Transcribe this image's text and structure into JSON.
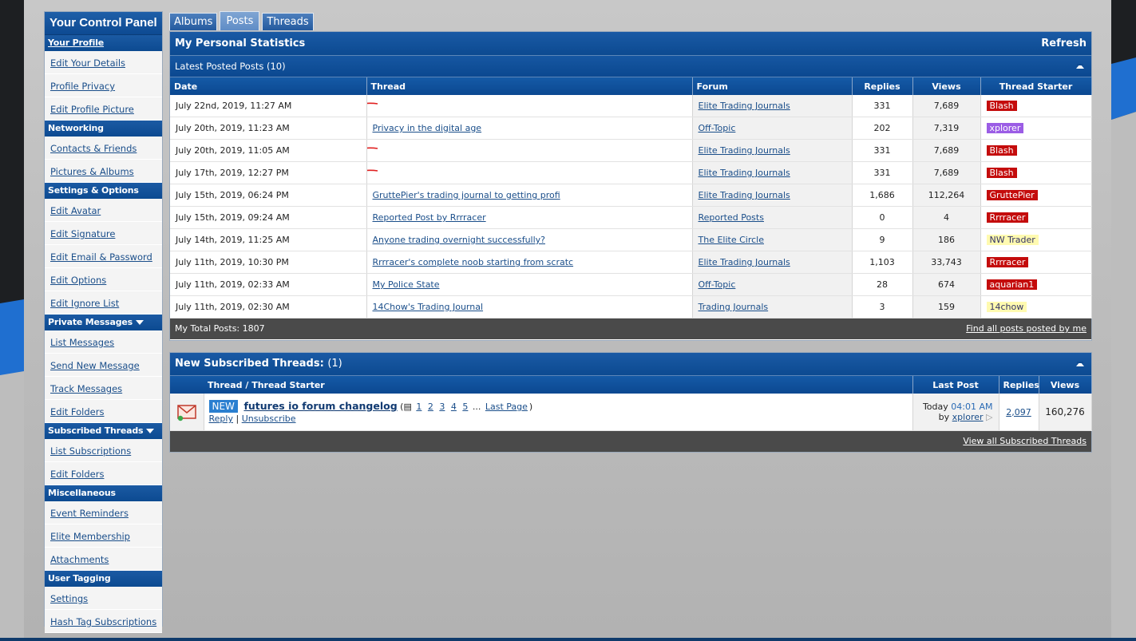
{
  "tabs": [
    {
      "label": "Albums",
      "active": false
    },
    {
      "label": "Posts",
      "active": true
    },
    {
      "label": "Threads",
      "active": false
    }
  ],
  "sidebar": {
    "title": "Your Control Panel",
    "sections": [
      {
        "heading": "Your Profile",
        "link": true,
        "caret": false,
        "items": [
          "Edit Your Details",
          "Profile Privacy",
          "Edit Profile Picture"
        ]
      },
      {
        "heading": "Networking",
        "link": false,
        "caret": false,
        "items": [
          "Contacts & Friends",
          "Pictures & Albums"
        ]
      },
      {
        "heading": "Settings & Options",
        "link": false,
        "caret": false,
        "items": [
          "Edit Avatar",
          "Edit Signature",
          "Edit Email & Password",
          "Edit Options",
          "Edit Ignore List"
        ]
      },
      {
        "heading": "Private Messages",
        "link": false,
        "caret": true,
        "items": [
          "List Messages",
          "Send New Message",
          "Track Messages",
          "Edit Folders"
        ]
      },
      {
        "heading": "Subscribed Threads",
        "link": false,
        "caret": true,
        "items": [
          "List Subscriptions",
          "Edit Folders"
        ]
      },
      {
        "heading": "Miscellaneous",
        "link": false,
        "caret": false,
        "items": [
          "Event Reminders",
          "Elite Membership",
          "Attachments"
        ]
      },
      {
        "heading": "User Tagging",
        "link": false,
        "caret": false,
        "items": [
          "Settings",
          "Hash Tag Subscriptions"
        ]
      }
    ]
  },
  "stats": {
    "title": "My Personal Statistics",
    "refresh_label": "Refresh",
    "subtitle": "Latest Posted Posts (10)",
    "columns": [
      "Date",
      "Thread",
      "Forum",
      "Replies",
      "Views",
      "Thread Starter"
    ],
    "rows": [
      {
        "date": "July 22nd, 2019, 11:27 AM",
        "thread": "",
        "forum": "Elite Trading Journals",
        "replies": "331",
        "views": "7,689",
        "starter": "Blash",
        "badge": "red",
        "redacted": true
      },
      {
        "date": "July 20th, 2019, 11:23 AM",
        "thread": "Privacy in the digital age",
        "forum": "Off-Topic",
        "replies": "202",
        "views": "7,319",
        "starter": "xplorer",
        "badge": "purple",
        "redacted": false
      },
      {
        "date": "July 20th, 2019, 11:05 AM",
        "thread": "",
        "forum": "Elite Trading Journals",
        "replies": "331",
        "views": "7,689",
        "starter": "Blash",
        "badge": "red",
        "redacted": true
      },
      {
        "date": "July 17th, 2019, 12:27 PM",
        "thread": "",
        "forum": "Elite Trading Journals",
        "replies": "331",
        "views": "7,689",
        "starter": "Blash",
        "badge": "red",
        "redacted": true
      },
      {
        "date": "July 15th, 2019, 06:24 PM",
        "thread": "GruttePier's trading journal to getting profi",
        "forum": "Elite Trading Journals",
        "replies": "1,686",
        "views": "112,264",
        "starter": "GruttePier",
        "badge": "red",
        "redacted": false
      },
      {
        "date": "July 15th, 2019, 09:24 AM",
        "thread": "Reported Post by Rrrracer",
        "forum": "Reported Posts",
        "replies": "0",
        "views": "4",
        "starter": "Rrrracer",
        "badge": "red",
        "redacted": false
      },
      {
        "date": "July 14th, 2019, 11:25 AM",
        "thread": "Anyone trading overnight successfully?",
        "forum": "The Elite Circle",
        "replies": "9",
        "views": "186",
        "starter": "NW Trader",
        "badge": "yellow",
        "redacted": false
      },
      {
        "date": "July 11th, 2019, 10:30 PM",
        "thread": "Rrrracer's complete noob starting from scratc",
        "forum": "Elite Trading Journals",
        "replies": "1,103",
        "views": "33,743",
        "starter": "Rrrracer",
        "badge": "red",
        "redacted": false
      },
      {
        "date": "July 11th, 2019, 02:33 AM",
        "thread": "My Police State",
        "forum": "Off-Topic",
        "replies": "28",
        "views": "674",
        "starter": "aquarian1",
        "badge": "red",
        "redacted": false
      },
      {
        "date": "July 11th, 2019, 02:30 AM",
        "thread": "14Chow's Trading Journal",
        "forum": "Trading Journals",
        "replies": "3",
        "views": "159",
        "starter": "14chow",
        "badge": "yellow",
        "redacted": false
      }
    ],
    "total_posts": "My Total Posts: 1807",
    "find_all_label": "Find all posts posted by me"
  },
  "subscribed": {
    "title": "New Subscribed Threads:",
    "count": "(1)",
    "columns": [
      "Thread / Thread Starter",
      "Last Post",
      "Replies",
      "Views"
    ],
    "thread": {
      "new_tag": "NEW",
      "title": "futures io forum changelog",
      "pages": [
        "1",
        "2",
        "3",
        "4",
        "5"
      ],
      "ellipsis": "...",
      "last_page_label": "Last Page",
      "reply_label": "Reply",
      "separator": "|",
      "unsubscribe_label": "Unsubscribe",
      "last_post_day": "Today",
      "last_post_time": "04:01 AM",
      "last_post_by": "by",
      "last_post_user": "xplorer",
      "replies": "2,097",
      "views": "160,276"
    },
    "view_all_label": "View all Subscribed Threads"
  },
  "colors": {
    "header_blue": "#0c4a91",
    "badge_red": "#c40c0c",
    "badge_purple": "#9b5de5",
    "badge_yellow": "#fffab0",
    "footer_gray": "#4a4a4a"
  },
  "icons": {
    "collapse": "collapse-icon",
    "mail": "envelope-icon",
    "pages": "multipage-icon",
    "dropdown": "caret-down-icon",
    "go_last": "goto-last-post-icon"
  }
}
